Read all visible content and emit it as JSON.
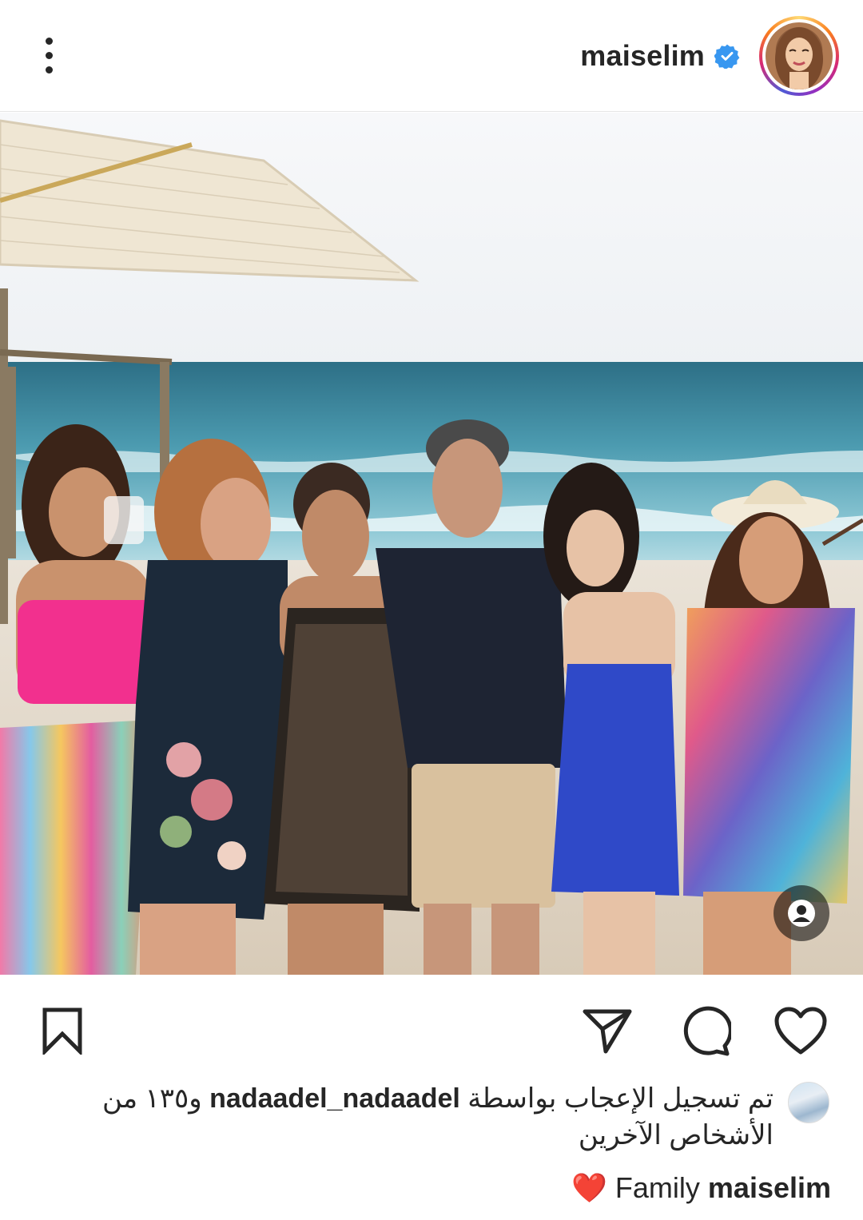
{
  "post": {
    "username": "maiselim",
    "verified": true
  },
  "likes": {
    "prefix": "تم تسجيل الإعجاب بواسطة",
    "user": "nadaadel_nadaadel",
    "suffix": "و١٣٥ من الأشخاص الآخرين"
  },
  "caption": {
    "username": "maiselim",
    "text": "Family",
    "emoji": "❤️"
  },
  "icons": {
    "more": "more-vertical-icon",
    "verified": "verified-badge-icon",
    "tag": "user-tag-icon",
    "save": "bookmark-icon",
    "share": "send-icon",
    "comment": "comment-icon",
    "like": "heart-icon"
  },
  "colors": {
    "verified": "#3897f0",
    "text": "#262626",
    "heart": "#e0245e"
  }
}
